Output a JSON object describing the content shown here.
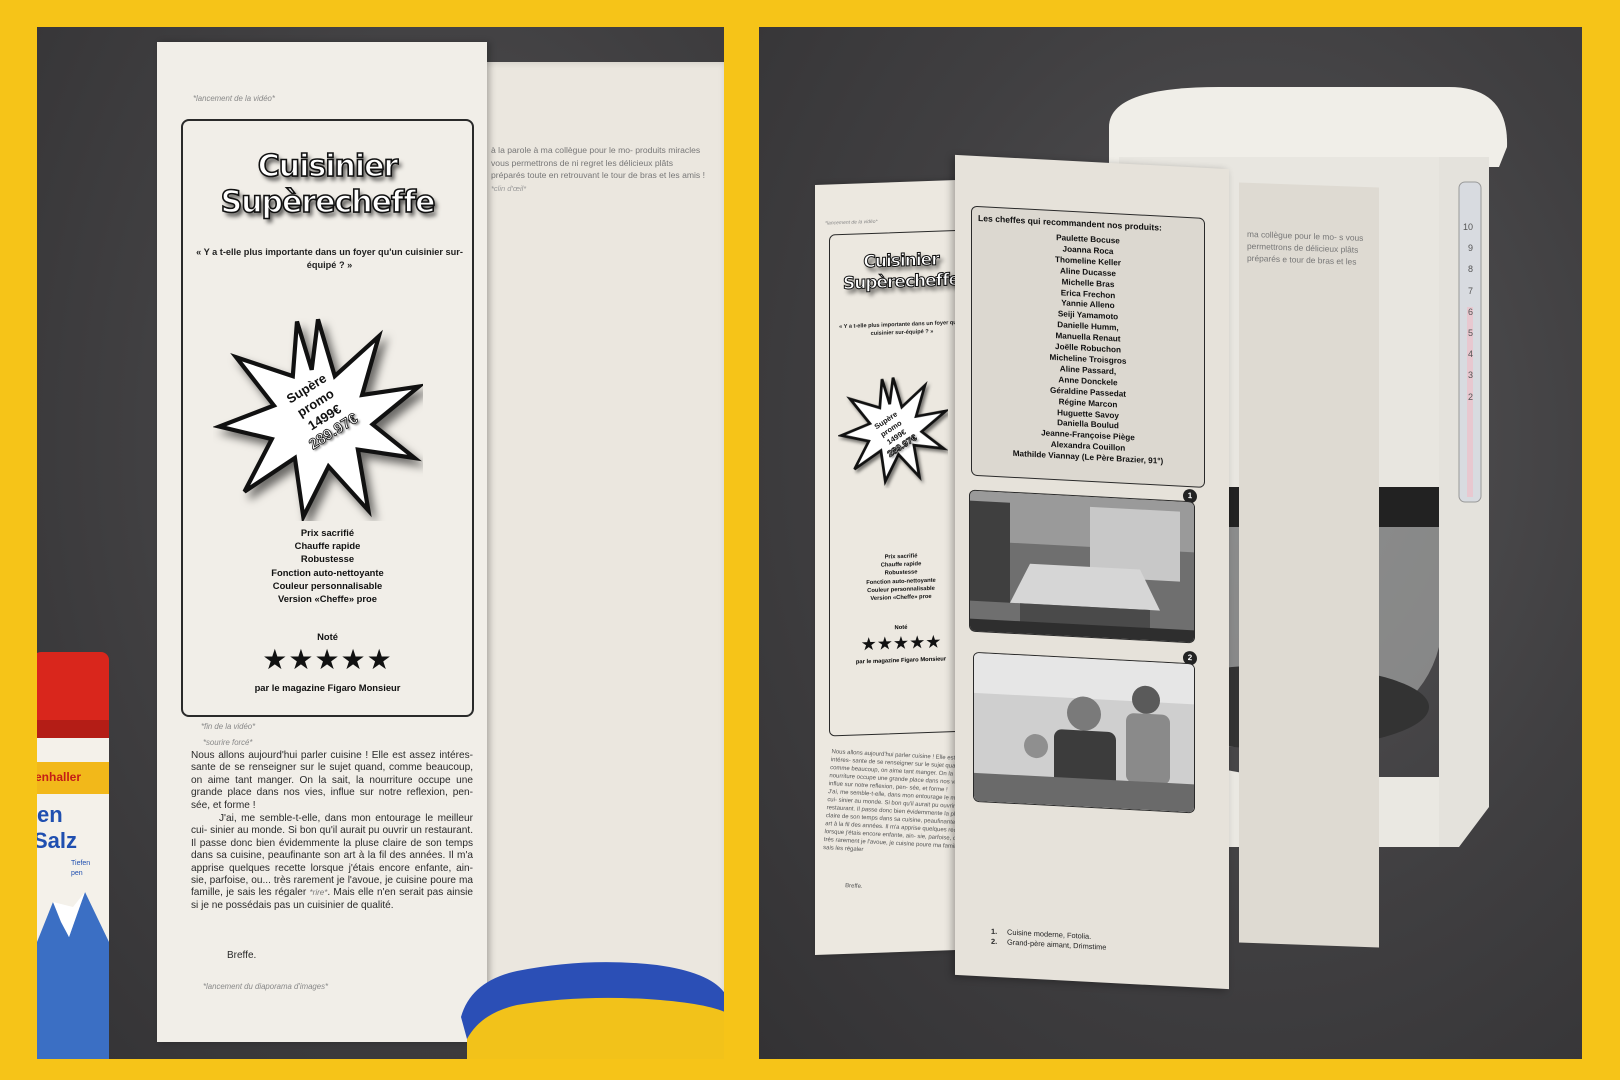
{
  "brand": {
    "line1": "Cuisinier",
    "line2": "Supèrecheffe"
  },
  "question": "« Y a t-elle plus importante dans un foyer qu'un cuisinier sur-équipé ? »",
  "promo": {
    "line1": "Supère",
    "line2": "promo",
    "price": "1499€",
    "old_price": "289.97€"
  },
  "features": [
    "Prix sacrifié",
    "Chauffe rapide",
    "Robustesse",
    "Fonction auto-nettoyante",
    "Couleur personnalisable",
    "Version «Cheffe» proe"
  ],
  "rating": {
    "label": "Noté",
    "stars": "★★★★★",
    "magazine": "par le magazine Figaro Monsieur"
  },
  "cues": {
    "video_start": "*lancement de la vidéo*",
    "video_end": "*fin de la vidéo*",
    "smile": "*sourire forcé*",
    "slideshow": "*lancement du diaporama d'images*",
    "wink": "*clin d'œil*"
  },
  "back_text": "à la parole à ma collègue pour le mo- produits miracles vous permettrons de ni regret les délicieux plâts préparés toute en retrouvant le tour de bras et les amis !",
  "back_text_short": "ma collègue pour le mo- s vous permettrons de délicieux plâts préparés e tour de bras et les",
  "body": {
    "p1": "Nous allons aujourd'hui parler cuisine ! Elle est assez intéres- sante de se renseigner sur le sujet quand, comme beaucoup, on aime tant manger. On la sait, la nourriture occupe une grande place dans nos vies, influe sur notre reflexion, pen- sée, et forme !",
    "p2": "J'ai, me semble-t-elle, dans mon entourage le meilleur cui- sinier au monde. Si bon qu'il aurait pu ouvrir un restaurant. Il passe donc bien évidemmente la pluse claire de son temps dans sa cuisine, peaufinante son art à la fil des années. Il m'a apprise quelques recette lorsque j'étais encore enfante, ain- sie, parfoise, ou... très rarement je l'avoue, je cuisine poure ma famille, je sais les régaler",
    "laugh": "*rire*",
    "p2_end": ". Mais elle n'en serait pas ainsie si je ne possédais pas un cuisinier de qualité.",
    "sign": "Breffe."
  },
  "chefs": {
    "title": "Les cheffes qui recommandent nos produits:",
    "names": [
      "Paulette Bocuse",
      "Joanna Roca",
      "Thomeline Keller",
      "Aline Ducasse",
      "Michelle Bras",
      "Erica Frechon",
      "Yannie Alleno",
      "Seiji Yamamoto",
      "Danielle Humm,",
      "Manuella Renaut",
      "Joëlle Robuchon",
      "Micheline Troisgros",
      "Aline Passard,",
      "Anne Donckele",
      "Géraldine Passedat",
      "Régine Marcon",
      "Huguette Savoy",
      "Daniella Boulud",
      "Jeanne-Françoise Piège",
      "Alexandra Couillon",
      "Mathilde Viannay (Le Père Brazier, 91°)"
    ]
  },
  "photos": {
    "num1": "1",
    "num2": "2"
  },
  "credits": [
    {
      "num": "1.",
      "text": "Cuisine moderne, Fotolia."
    },
    {
      "num": "2.",
      "text": "Grand-père aimant, Drimstime"
    }
  ],
  "salt_label": {
    "brand": "enhaller",
    "line1": "en",
    "line2": "Salz",
    "small1": "Tiefen",
    "small2": "pen"
  },
  "coffee_scale": [
    "10",
    "9",
    "8",
    "7",
    "6",
    "5",
    "4",
    "3",
    "2"
  ],
  "colors": {
    "frame": "#f6c418",
    "wall": "#444345",
    "paper": "#f1eee8",
    "ink": "#111111",
    "sponge_blue": "#2b4fb6",
    "sponge_yellow": "#f2c21a",
    "salt_red": "#d9261c"
  }
}
